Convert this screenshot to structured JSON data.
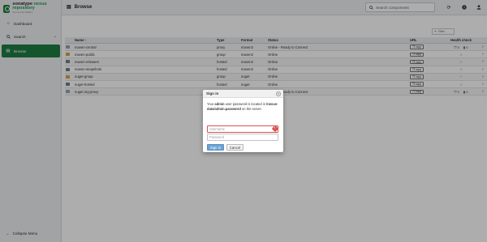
{
  "app": {
    "brand": "sonatype",
    "brand_accent": "nexus repository",
    "brand_sub": "Community Edition"
  },
  "sidebar": {
    "items": [
      {
        "label": "Dashboard",
        "icon": "home-icon"
      },
      {
        "label": "Search",
        "icon": "search-icon"
      },
      {
        "label": "Browse",
        "icon": "browse-icon",
        "active": true
      }
    ],
    "collapse_label": "Collapse Menu"
  },
  "header": {
    "title": "Browse",
    "search_placeholder": "Search components"
  },
  "filter": {
    "placeholder": "Filter"
  },
  "table": {
    "columns": [
      "Name ↑",
      "Type",
      "Format",
      "Status",
      "URL",
      "Health check"
    ],
    "copy_label": "copy",
    "rows": [
      {
        "name": "maven-central",
        "type": "proxy",
        "format": "maven2",
        "status": "Online - Ready to Connect",
        "kind": "proxy",
        "health": true
      },
      {
        "name": "maven-public",
        "type": "group",
        "format": "maven2",
        "status": "Online",
        "kind": "group",
        "health": false
      },
      {
        "name": "maven-releases",
        "type": "hosted",
        "format": "maven2",
        "status": "Online",
        "kind": "hosted",
        "health": false
      },
      {
        "name": "maven-snapshots",
        "type": "hosted",
        "format": "maven2",
        "status": "Online",
        "kind": "hosted",
        "health": false
      },
      {
        "name": "nuget-group",
        "type": "group",
        "format": "nuget",
        "status": "Online",
        "kind": "group",
        "health": false
      },
      {
        "name": "nuget-hosted",
        "type": "hosted",
        "format": "nuget",
        "status": "Online",
        "kind": "hosted",
        "health": false
      },
      {
        "name": "nuget.org-proxy",
        "type": "proxy",
        "format": "nuget",
        "status": "Online - Ready to Connect",
        "kind": "proxy",
        "health": true
      }
    ],
    "health_counts": [
      "0",
      "0"
    ]
  },
  "dialog": {
    "title": "Sign in",
    "msg_prefix": "Your ",
    "msg_user": "admin",
    "msg_middle": " user password is located in ",
    "msg_path": "/nexus-data/admin.password",
    "msg_suffix": " on the server.",
    "username_placeholder": "Username",
    "password_placeholder": "Password",
    "signin_label": "Sign in",
    "cancel_label": "Cancel"
  },
  "colors": {
    "accent_green": "#1e7e45",
    "primary_blue": "#6aa3d6",
    "error_red": "#d9534f"
  }
}
